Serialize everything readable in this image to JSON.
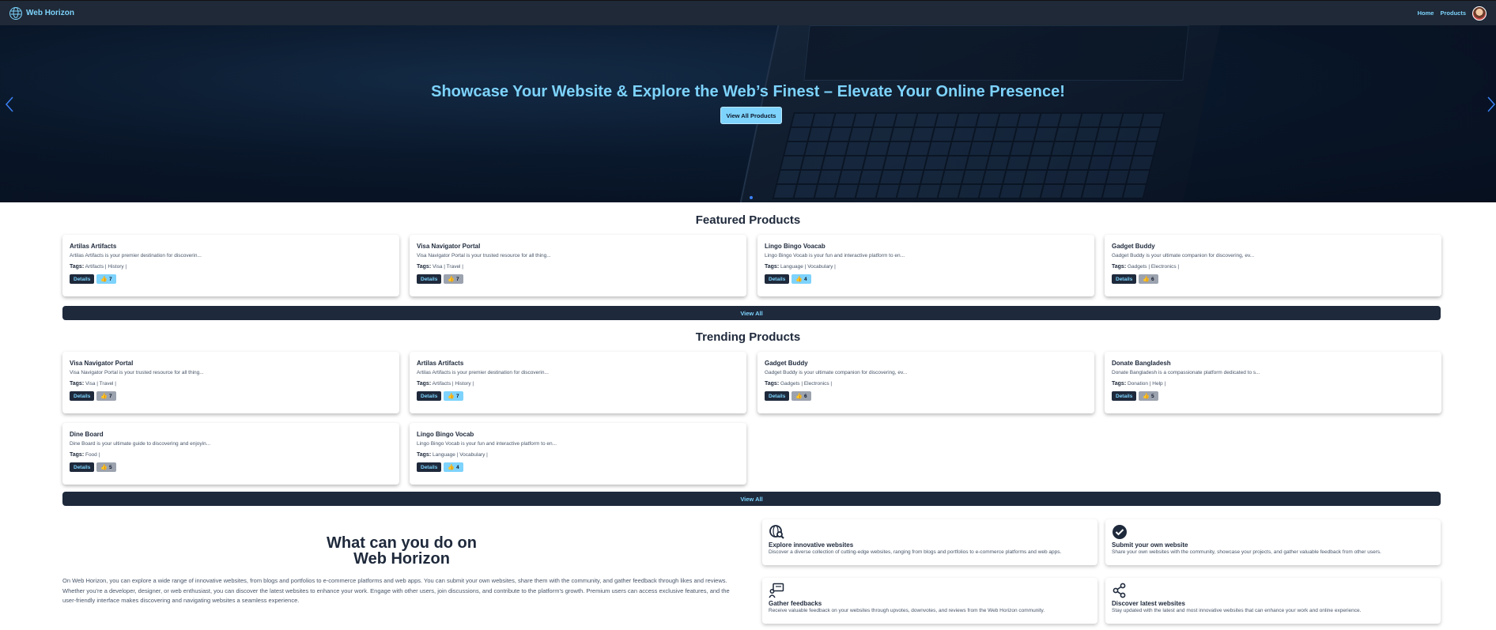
{
  "nav": {
    "brand": "Web Horizon",
    "links": [
      "Home",
      "Products"
    ]
  },
  "hero": {
    "title": "Showcase Your Website & Explore the Web’s Finest – Elevate Your Online Presence!",
    "button": "View All Products"
  },
  "featured": {
    "title": "Featured Products",
    "view_all": "View All",
    "cards": [
      {
        "name": "Artilas Artifacts",
        "desc": "Artilas Artifacts is your premier destination for discoverin...",
        "tags": "Artifacts | History |",
        "votes": "7",
        "vote_style": "blue"
      },
      {
        "name": "Visa Navigator Portal",
        "desc": "Visa Navigator Portal is your trusted resource for all thing...",
        "tags": "Visa | Travel |",
        "votes": "7",
        "vote_style": "gray"
      },
      {
        "name": "Lingo Bingo Voacab",
        "desc": "Lingo Bingo Vocab is your fun and interactive platform to en...",
        "tags": "Language | Vocabulary |",
        "votes": "4",
        "vote_style": "blue"
      },
      {
        "name": "Gadget Buddy",
        "desc": "Gadget Buddy is your ultimate companion for discovering, ev...",
        "tags": "Gadgets | Electronics |",
        "votes": "6",
        "vote_style": "gray"
      }
    ]
  },
  "trending": {
    "title": "Trending Products",
    "view_all": "View All",
    "cards": [
      {
        "name": "Visa Navigator Portal",
        "desc": "Visa Navigator Portal is your trusted resource for all thing...",
        "tags": "Visa | Travel |",
        "votes": "7",
        "vote_style": "gray"
      },
      {
        "name": "Artilas Artifacts",
        "desc": "Artilas Artifacts is your premier destination for discoverin...",
        "tags": "Artifacts | History |",
        "votes": "7",
        "vote_style": "blue"
      },
      {
        "name": "Gadget Buddy",
        "desc": "Gadget Buddy is your ultimate companion for discovering, ev...",
        "tags": "Gadgets | Electronics |",
        "votes": "6",
        "vote_style": "gray"
      },
      {
        "name": "Donate Bangladesh",
        "desc": "Donate Bangladesh is a compassionate platform dedicated to s...",
        "tags": "Donation | Help |",
        "votes": "5",
        "vote_style": "gray"
      },
      {
        "name": "Dine Board",
        "desc": "Dine Board is your ultimate guide to discovering and enjoyin...",
        "tags": "Food |",
        "votes": "5",
        "vote_style": "gray"
      },
      {
        "name": "Lingo Bingo Vocab",
        "desc": "Lingo Bingo Vocab is your fun and interactive platform to en...",
        "tags": "Language | Vocabulary |",
        "votes": "4",
        "vote_style": "blue"
      }
    ]
  },
  "tags_label": "Tags:",
  "details_label": "Details",
  "about": {
    "title_line1": "What can you do on",
    "title_line2": "Web Horizon",
    "text": "On Web Horizon, you can explore a wide range of innovative websites, from blogs and portfolios to e-commerce platforms and web apps. You can submit your own websites, share them with the community, and gather feedback through likes and reviews. Whether you're a developer, designer, or web enthusiast, you can discover the latest websites to enhance your work. Engage with other users, join discussions, and contribute to the platform's growth. Premium users can access exclusive features, and the user-friendly interface makes discovering and navigating websites a seamless experience."
  },
  "features": [
    {
      "icon": "globe-search-icon",
      "title": "Explore innovative websites",
      "desc": "Discover a diverse collection of cutting-edge websites, ranging from blogs and portfolios to e-commerce platforms and web apps."
    },
    {
      "icon": "check-circle-icon",
      "title": "Submit your own website",
      "desc": "Share your own websites with the community, showcase your projects, and gather valuable feedback from other users."
    },
    {
      "icon": "feedback-icon",
      "title": "Gather feedbacks",
      "desc": "Receive valuable feedback on your websites through upvotes, downvotes, and reviews from the Web Horizon community."
    },
    {
      "icon": "share-nodes-icon",
      "title": "Discover latest websites",
      "desc": "Stay updated with the latest and most innovative websites that can enhance your work and online experience."
    }
  ],
  "colors": {
    "accent": "#7dd3fc",
    "dark": "#1e293b",
    "vote_gray": "#9ca3af"
  }
}
